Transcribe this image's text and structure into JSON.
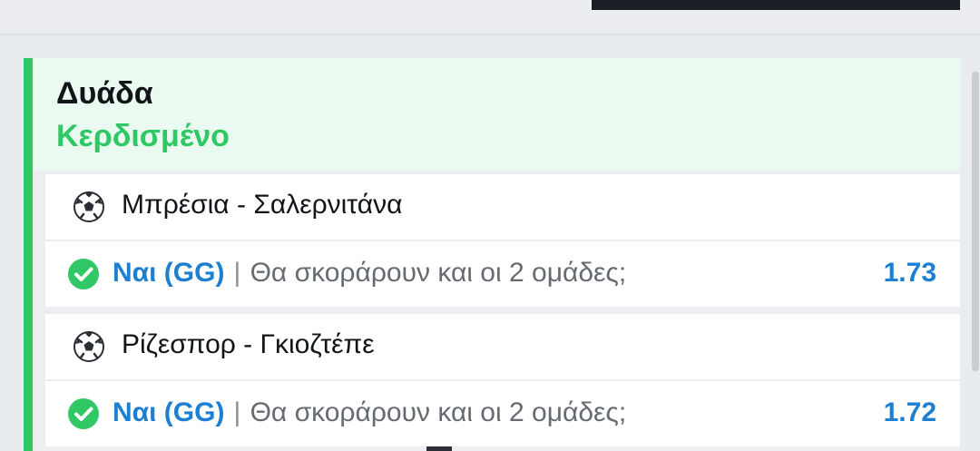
{
  "bet": {
    "type": "Δυάδα",
    "status": "Κερδισμένο"
  },
  "matches": [
    {
      "name": "Μπρέσια - Σαλερνιτάνα",
      "sport_icon": "soccer-ball-icon",
      "selection": "Ναι (GG)",
      "separator": "|",
      "market": "Θα σκοράρουν και οι 2 ομάδες;",
      "odds": "1.73",
      "result_icon": "check-circle-icon"
    },
    {
      "name": "Ρίζεσπορ - Γκιοζτέπε",
      "sport_icon": "soccer-ball-icon",
      "selection": "Ναι (GG)",
      "separator": "|",
      "market": "Θα σκοράρουν και οι 2 ομάδες;",
      "odds": "1.72",
      "result_icon": "check-circle-icon"
    }
  ],
  "colors": {
    "accent_green": "#2fc865",
    "odds_blue": "#1d7fd0",
    "header_bg": "#eafaf0"
  }
}
